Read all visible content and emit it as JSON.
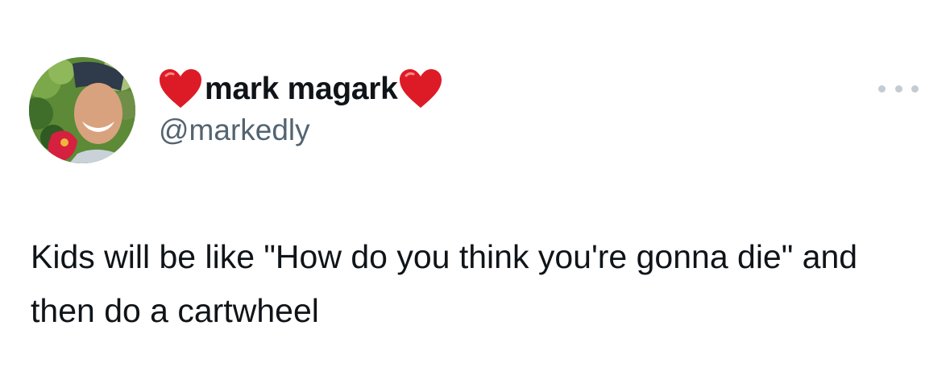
{
  "author": {
    "display_name": "mark magark",
    "handle": "@markedly",
    "name_prefix_emoji": "red-heart",
    "name_suffix_emoji": "red-heart"
  },
  "tweet": {
    "text": "Kids will be like \"How do you think you're gonna die\" and then do a cartwheel"
  },
  "menu": {
    "icon": "more-options-icon"
  },
  "colors": {
    "text": "#0f1419",
    "secondary_text": "#536471",
    "heart": "#dd1b26",
    "menu_dots": "#c3ccd3"
  }
}
